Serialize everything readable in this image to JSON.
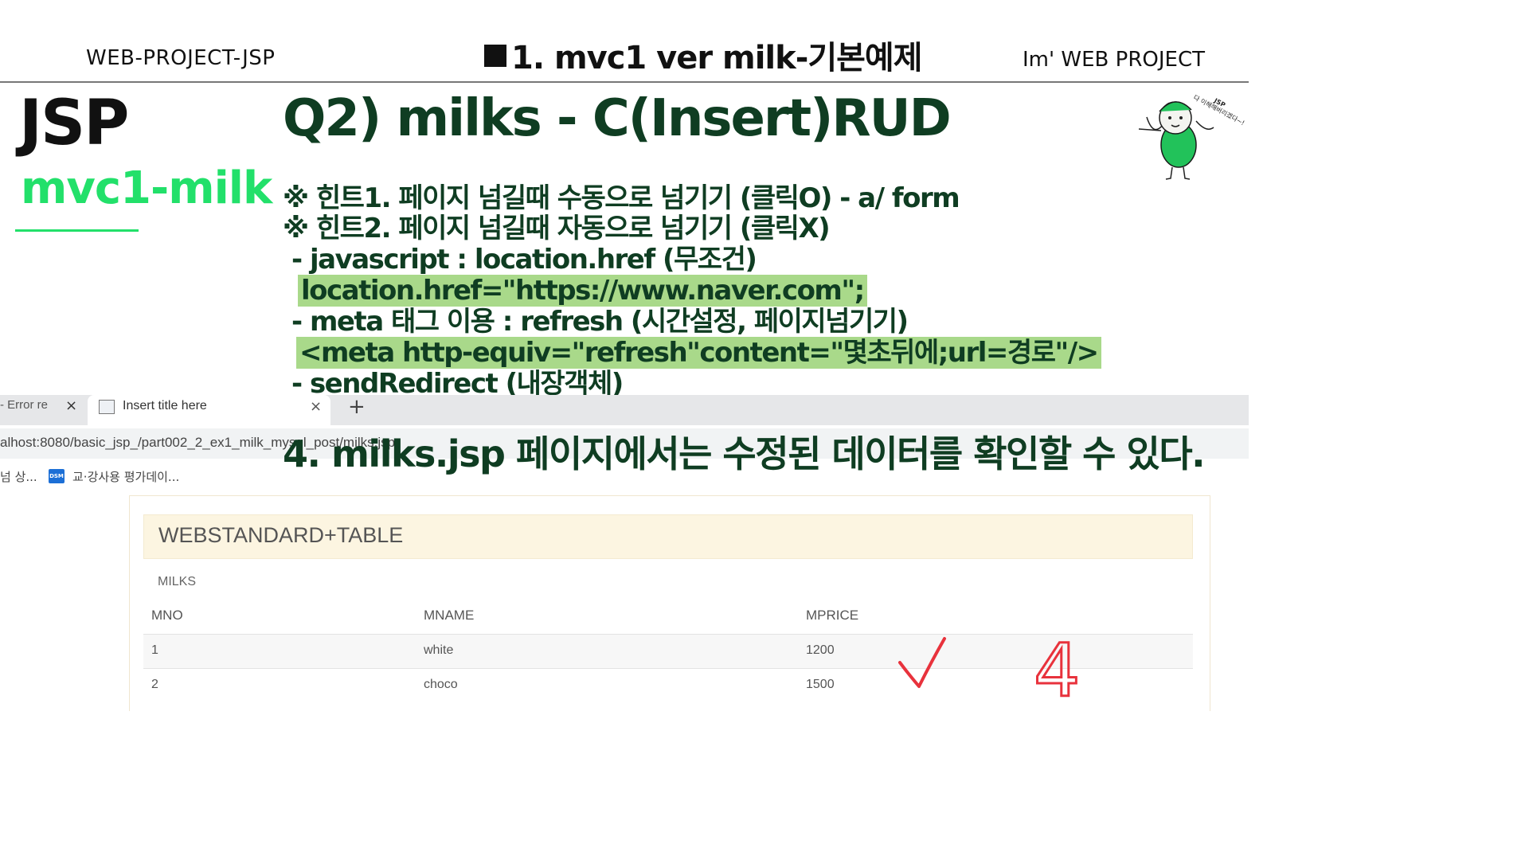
{
  "header": {
    "left": "WEB-PROJECT-JSP",
    "center": "1. mvc1 ver  milk-기본예제",
    "right": "Im'  WEB PROJECT"
  },
  "side": {
    "title": "JSP",
    "subtitle": "mvc1-milk"
  },
  "question": "Q2) milks - C(Insert)RUD",
  "hints": [
    "※ 힌트1. 페이지 넘길때 수동으로 넘기기 (클릭O)  - a/ form",
    "※ 힌트2. 페이지 넘길때 자동으로 넘기기 (클릭X)",
    "- javascript : location.href (무조건)",
    "location.href=\"https://www.naver.com\";",
    "- meta 태그 이용 : refresh (시간설정, 페이지넘기기)",
    "<meta http-equiv=\"refresh\"content=\"몇초뒤에;url=경로\"/>",
    "- sendRedirect (내장객체)"
  ],
  "mascot_text": "다 이해해버리겠다~!",
  "mascot_label": "JSP",
  "browser": {
    "tab_prev": "- Error re",
    "tab_active": "Insert title here",
    "tab_close": "×",
    "tab_new": "+",
    "url": "alhost:8080/basic_jsp_/part002_2_ex1_milk_mysql_post/milks.jsp",
    "bookmark_1": "넘 상...",
    "bookmark_icon": "DSM",
    "bookmark_2": "교·강사용 평가데이..."
  },
  "step4": "4. milks.jsp 페이지에서는  수정된 데이터를 확인할 수 있다.",
  "table": {
    "heading": "WEBSTANDARD+TABLE",
    "caption": "MILKS",
    "columns": [
      "MNO",
      "MNAME",
      "MPRICE"
    ],
    "rows": [
      [
        "1",
        "white",
        "1200"
      ],
      [
        "2",
        "choco",
        "1500"
      ]
    ]
  },
  "annotation": "4",
  "colors": {
    "dark_green": "#0f3d22",
    "bright_green": "#22e06a",
    "highlight": "#a9d98a",
    "red_mark": "#e8323c"
  }
}
